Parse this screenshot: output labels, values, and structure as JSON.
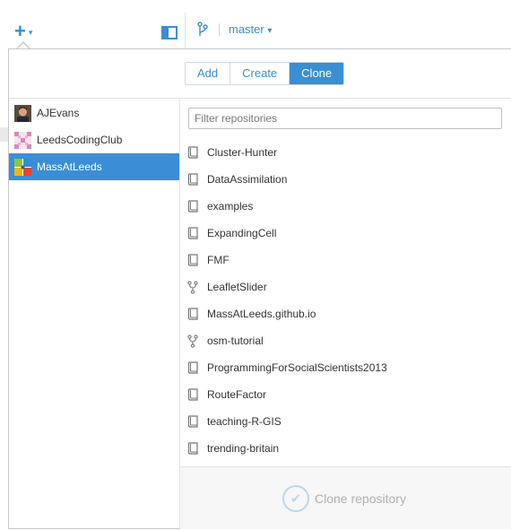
{
  "toolbar": {
    "add_icon": "plus-icon",
    "add_caret": "▾",
    "sidebar_toggle_icon": "panel-toggle-icon",
    "branch_icon": "branch-icon",
    "branch_name": "master",
    "branch_caret": "▾",
    "accent": "#3a8fd0"
  },
  "tabs": [
    {
      "label": "Add",
      "active": false
    },
    {
      "label": "Create",
      "active": false
    },
    {
      "label": "Clone",
      "active": true
    }
  ],
  "accounts": [
    {
      "name": "AJEvans",
      "selected": false
    },
    {
      "name": "LeedsCodingClub",
      "selected": false
    },
    {
      "name": "MassAtLeeds",
      "selected": true
    }
  ],
  "filter": {
    "placeholder": "Filter repositories",
    "value": ""
  },
  "repos": [
    {
      "name": "Cluster-Hunter",
      "icon": "repo-icon"
    },
    {
      "name": "DataAssimilation",
      "icon": "repo-icon"
    },
    {
      "name": "examples",
      "icon": "repo-icon"
    },
    {
      "name": "ExpandingCell",
      "icon": "repo-icon"
    },
    {
      "name": "FMF",
      "icon": "repo-icon"
    },
    {
      "name": "LeafletSlider",
      "icon": "fork-icon"
    },
    {
      "name": "MassAtLeeds.github.io",
      "icon": "repo-icon"
    },
    {
      "name": "osm-tutorial",
      "icon": "fork-icon"
    },
    {
      "name": "ProgrammingForSocialScientists2013",
      "icon": "repo-icon"
    },
    {
      "name": "RouteFactor",
      "icon": "repo-icon"
    },
    {
      "name": "teaching-R-GIS",
      "icon": "repo-icon"
    },
    {
      "name": "trending-britain",
      "icon": "repo-icon"
    }
  ],
  "footer": {
    "clone_label": "Clone repository",
    "icon": "check-circle-icon",
    "disabled": true
  },
  "colors": {
    "selected": "#3b8ed6",
    "accent": "#3a8fd0",
    "disabled": "#b0b0b0"
  }
}
